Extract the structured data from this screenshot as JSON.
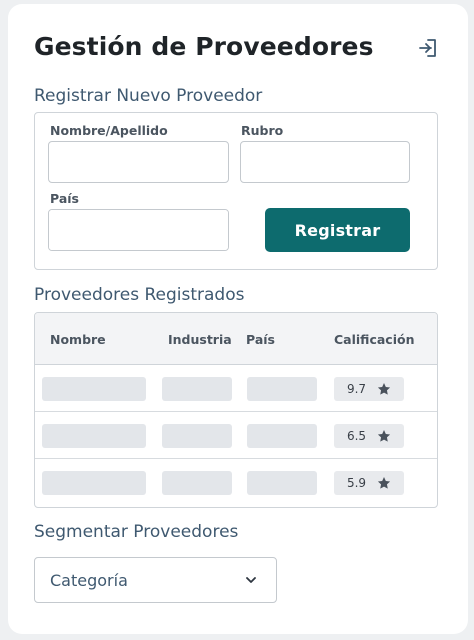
{
  "header": {
    "title": "Gestión de Proveedores",
    "logout_icon": "logout-icon"
  },
  "register_form": {
    "section_title": "Registrar Nuevo Proveedor",
    "name_label": "Nombre/Apellido",
    "name_value": "",
    "category_label": "Rubro",
    "category_value": "",
    "country_label": "País",
    "country_value": "",
    "country_icon": "globe-icon",
    "submit_label": "Registrar",
    "accent_color": "#0d6b6e"
  },
  "registered": {
    "section_title": "Proveedores Registrados",
    "columns": [
      "Nombre",
      "Industria",
      "País",
      "Calificación"
    ],
    "rows": [
      {
        "rating": "9.7"
      },
      {
        "rating": "6.5"
      },
      {
        "rating": "5.9"
      }
    ],
    "rating_icon": "star-icon"
  },
  "segment": {
    "section_title": "Segmentar Proveedores",
    "selected": "Categoría",
    "dropdown_icon": "chevron-down-icon"
  }
}
